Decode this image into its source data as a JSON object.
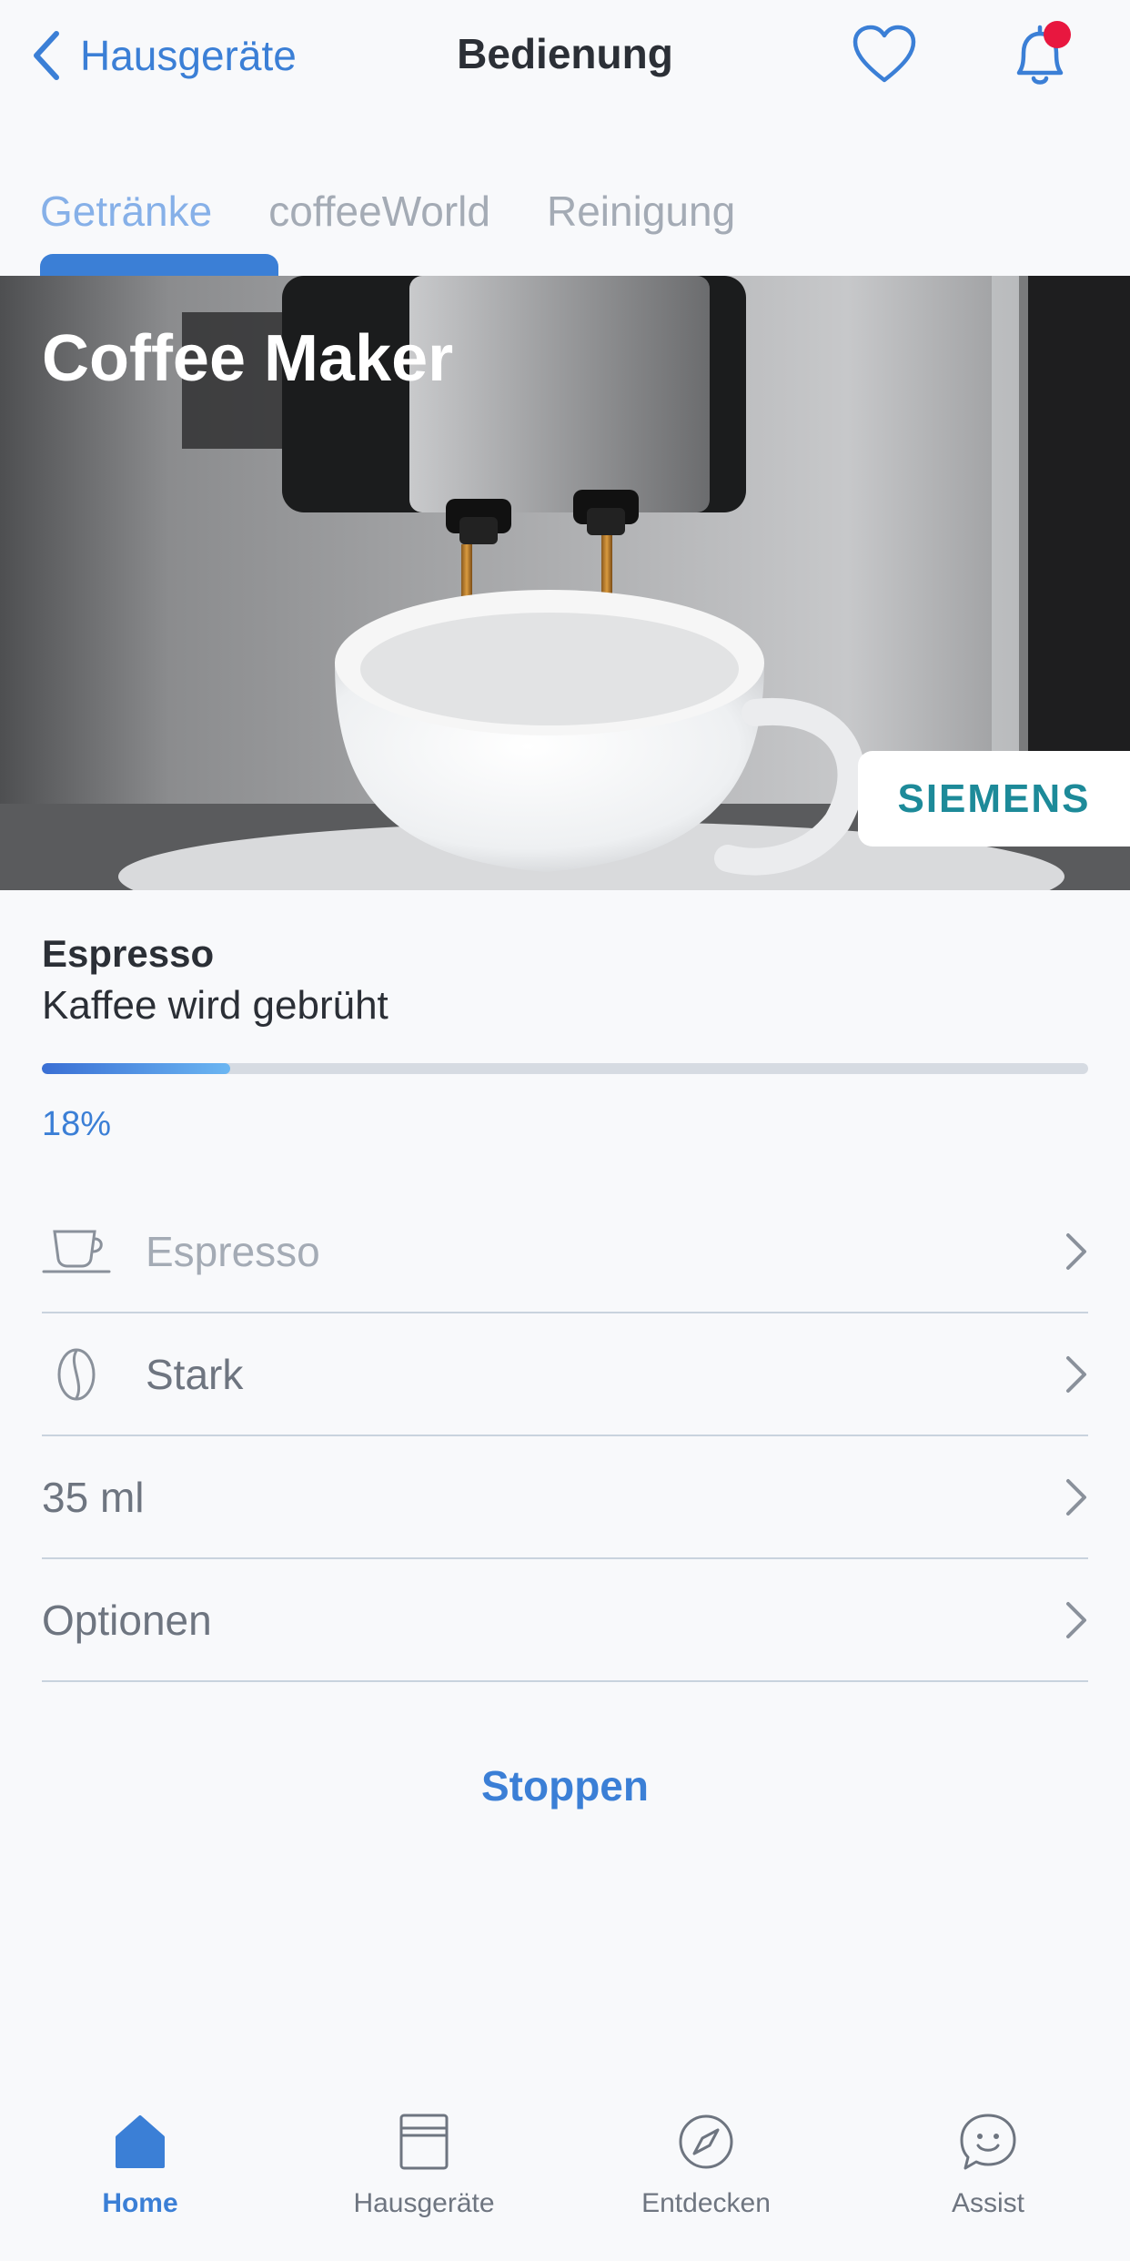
{
  "header": {
    "back_label": "Hausgeräte",
    "title": "Bedienung"
  },
  "tabs": [
    {
      "label": "Getränke",
      "active": true
    },
    {
      "label": "coffeeWorld",
      "active": false
    },
    {
      "label": "Reinigung",
      "active": false
    }
  ],
  "hero": {
    "title": "Coffee Maker",
    "brand": "SIEMENS"
  },
  "status": {
    "program": "Espresso",
    "state": "Kaffee wird gebrüht",
    "progress": 0.18,
    "progress_label": "18%"
  },
  "settings": [
    {
      "label": "Espresso",
      "icon": "cup-icon"
    },
    {
      "label": "Stark",
      "icon": "coffee-bean-icon"
    },
    {
      "label": "35 ml",
      "icon": ""
    },
    {
      "label": "Optionen",
      "icon": ""
    }
  ],
  "stop_label": "Stoppen",
  "bottom_nav": [
    {
      "label": "Home",
      "icon": "home-icon",
      "active": true
    },
    {
      "label": "Hausgeräte",
      "icon": "appliance-icon",
      "active": false
    },
    {
      "label": "Entdecken",
      "icon": "compass-icon",
      "active": false
    },
    {
      "label": "Assist",
      "icon": "assist-chat-icon",
      "active": false
    }
  ],
  "colors": {
    "accent": "#3b7fd6",
    "brand": "#1d8a99",
    "notification": "#e8173f",
    "background": "#f8f9fb"
  }
}
